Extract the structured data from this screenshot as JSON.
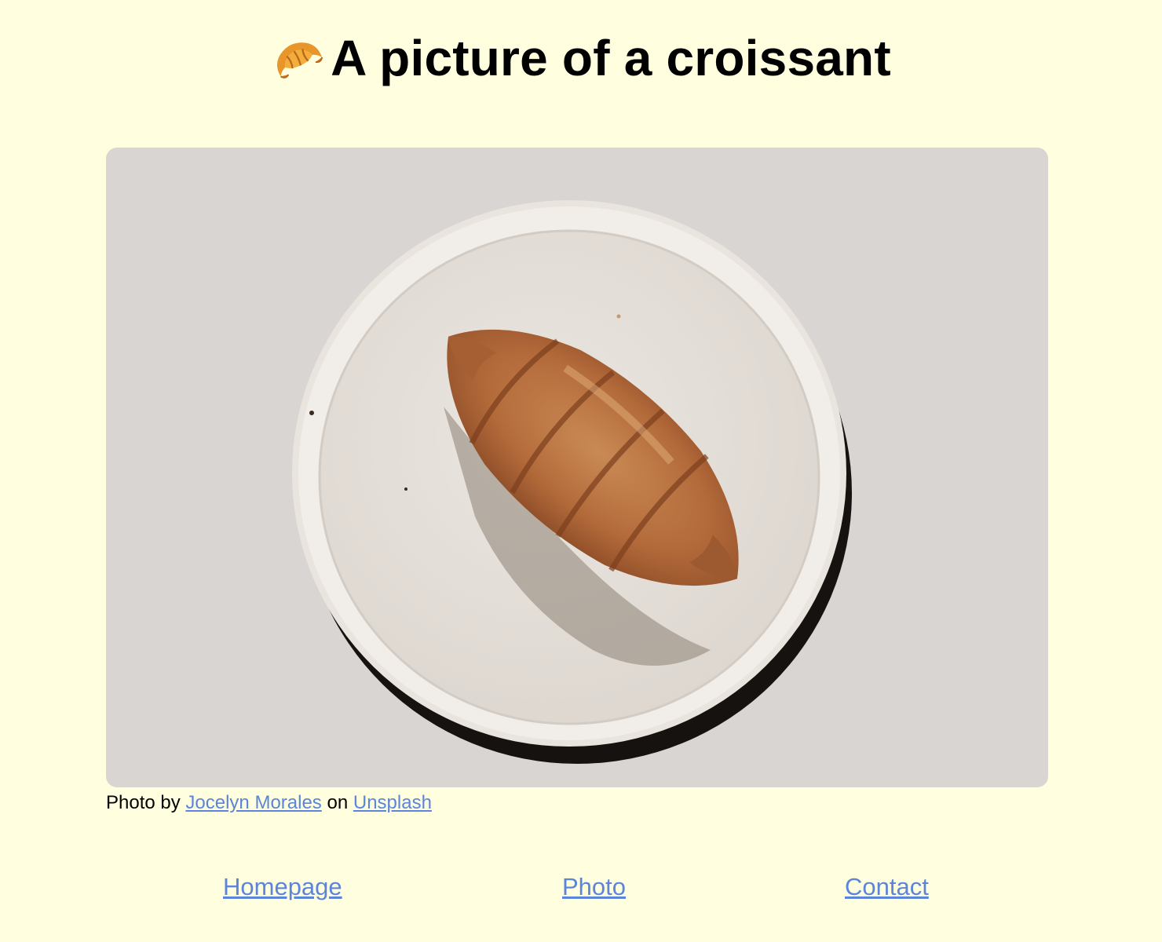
{
  "header": {
    "title": "A picture of a croissant",
    "emoji_icon": "croissant-icon"
  },
  "photo": {
    "subject": "croissant on a white plate",
    "caption_prefix": "Photo by",
    "author_link": "Jocelyn Morales",
    "caption_middle": "on",
    "source_link": "Unsplash"
  },
  "nav": {
    "items": [
      {
        "label": "Homepage"
      },
      {
        "label": "Photo"
      },
      {
        "label": "Contact"
      }
    ]
  },
  "colors": {
    "page_background": "#ffffe0",
    "link": "#5b85d9",
    "text": "#000000"
  }
}
